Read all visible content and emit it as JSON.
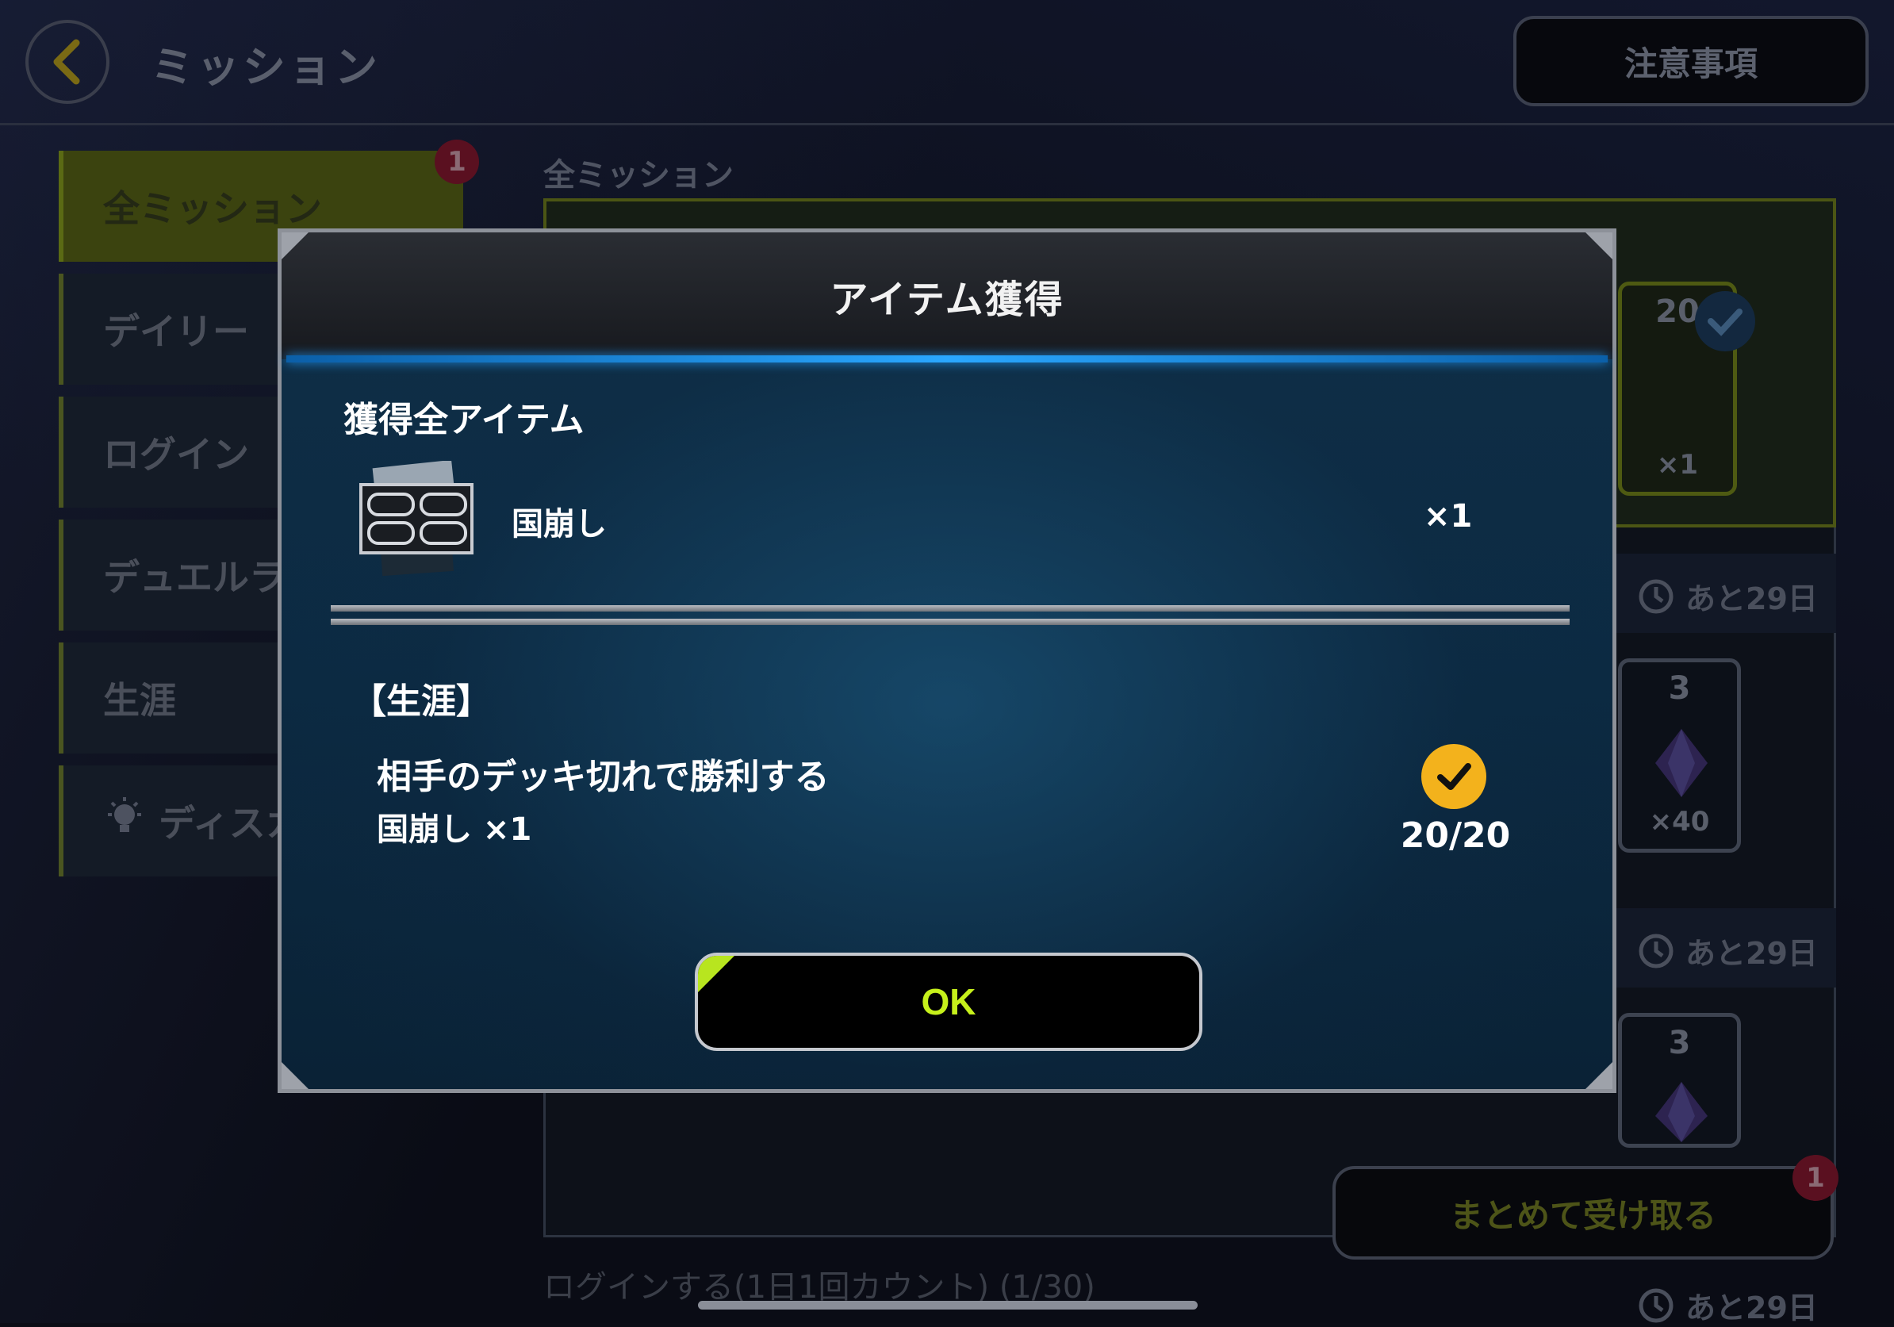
{
  "header": {
    "title": "ミッション",
    "notes_label": "注意事項"
  },
  "sidebar": {
    "items": [
      {
        "label": "全ミッション",
        "badge": "1"
      },
      {
        "label": "デイリー"
      },
      {
        "label": "ログイン"
      },
      {
        "label": "デュエルラ"
      },
      {
        "label": "生涯"
      },
      {
        "label": "ディスカ"
      }
    ]
  },
  "main": {
    "section_label": "全ミッション",
    "rewards": [
      {
        "count": "20",
        "qty": "×1"
      },
      {
        "count": "3",
        "qty": "×40"
      },
      {
        "count": "3",
        "qty": ""
      }
    ],
    "remaining": [
      "あと29日",
      "あと29日",
      "あと29日"
    ],
    "collect_all_label": "まとめて受け取る",
    "collect_badge": "1",
    "bottom_row": "ログインする(1日1回カウント) (1/30)"
  },
  "dialog": {
    "title": "アイテム獲得",
    "all_items_title": "獲得全アイテム",
    "item": {
      "name": "国崩し",
      "qty": "×1"
    },
    "mission_category": "【生涯】",
    "mission_name": "相手のデッキ切れで勝利する",
    "mission_reward": "国崩し ×1",
    "progress": "20/20",
    "ok_label": "OK"
  },
  "colors": {
    "accent": "#c6f01b",
    "check": "#f3b21c",
    "header_line": "#2aa7ff"
  },
  "icons": [
    "back-arrow-icon",
    "bulb-icon",
    "clock-icon",
    "check-icon",
    "card-item-icon",
    "crystal-icon"
  ]
}
